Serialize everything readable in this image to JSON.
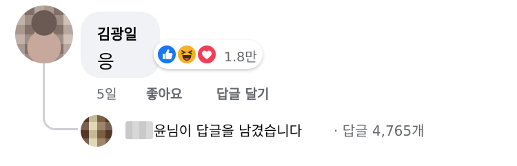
{
  "comment": {
    "author": "김광일",
    "text": "응",
    "reactions": {
      "icons": [
        "like-icon",
        "haha-icon",
        "love-icon"
      ],
      "count": "1.8만"
    },
    "time": "5일",
    "like_label": "좋아요",
    "reply_label": "답글 달기"
  },
  "replies_summary": {
    "name_suffix": "윤님이 답글을 남겼습니다",
    "meta": "· 답글 4,765개"
  },
  "colors": {
    "like": "#1877f2",
    "haha": "#f7b125",
    "love": "#f33e58",
    "secondary_text": "#65676b",
    "bubble": "#f0f2f5"
  }
}
